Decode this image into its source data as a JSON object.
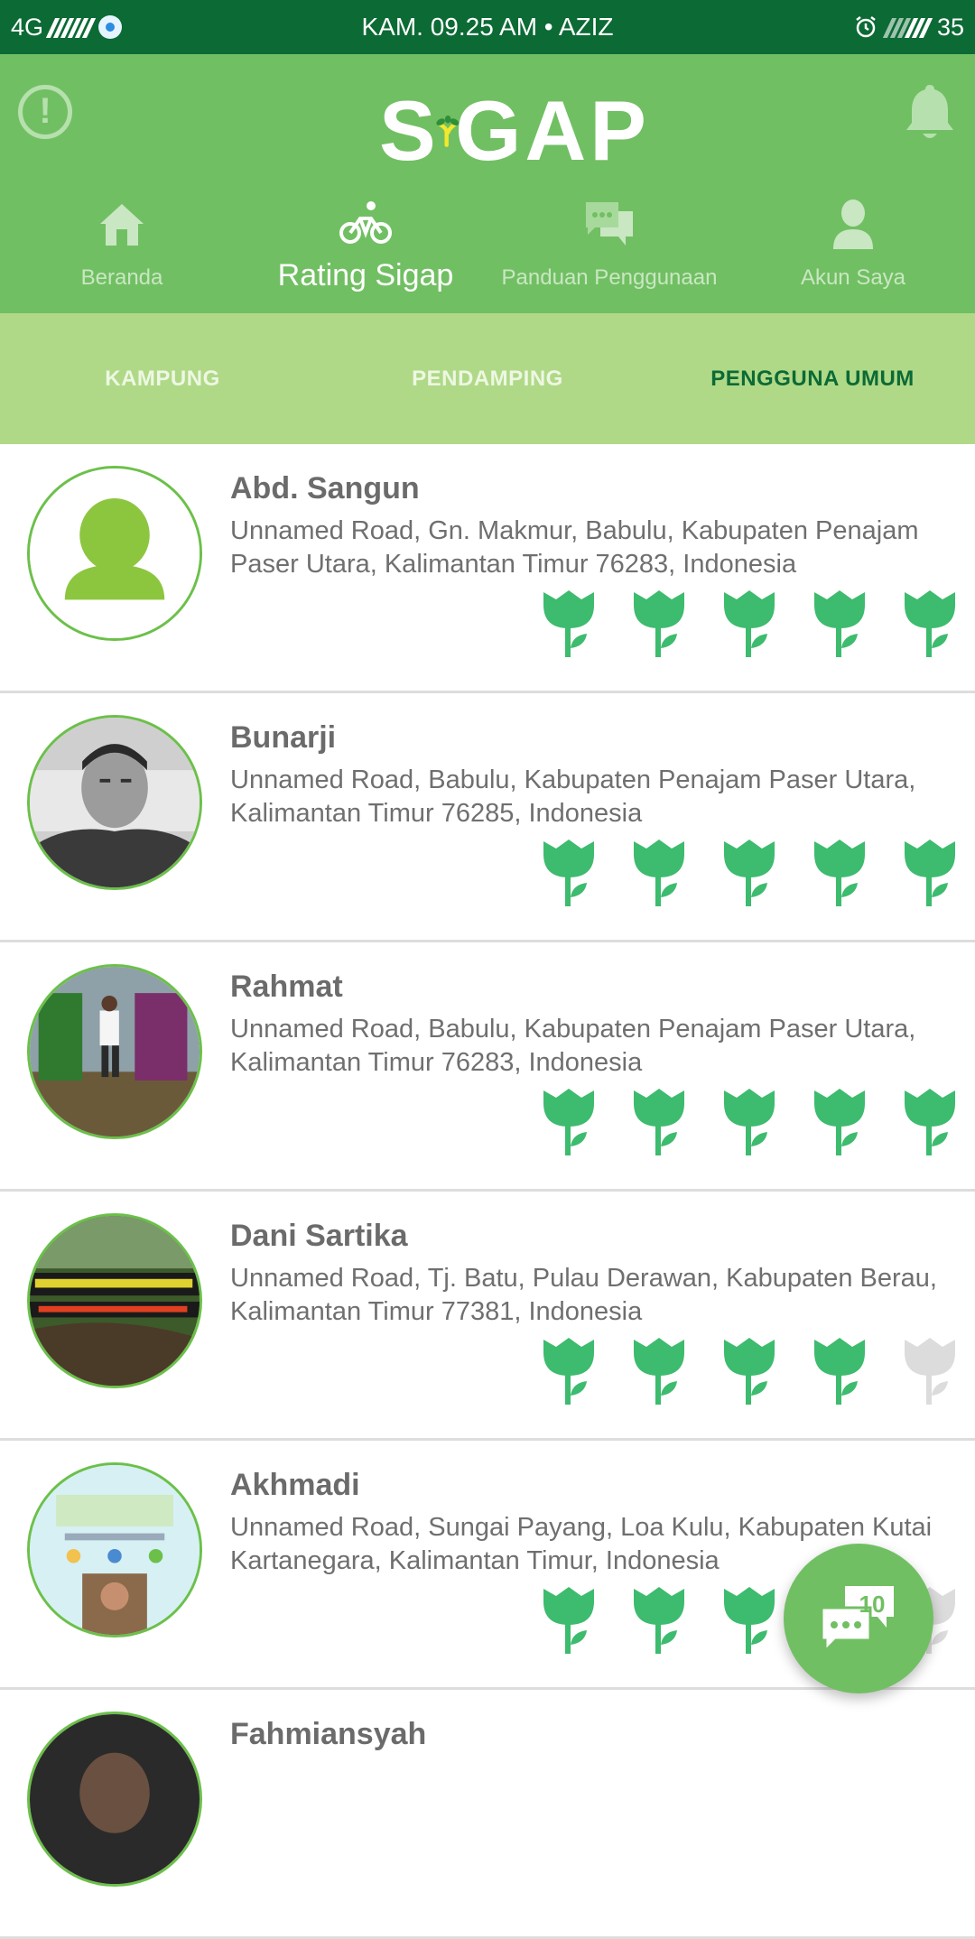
{
  "status_bar": {
    "network": "4G",
    "center_text": "KAM. 09.25 AM • AZIZ",
    "battery": "35",
    "icons": [
      "signal-icon",
      "data-saver-icon",
      "alarm-icon",
      "battery-icon"
    ]
  },
  "header": {
    "logo_left": "S",
    "logo_right": "GAP",
    "icons": [
      "alert-icon",
      "bell-icon"
    ]
  },
  "nav_tabs": [
    {
      "label": "Beranda",
      "icon": "home-icon",
      "active": false
    },
    {
      "label": "Rating Sigap",
      "icon": "bike-icon",
      "active": true
    },
    {
      "label": "Panduan Penggunaan",
      "icon": "chat-icon",
      "active": false
    },
    {
      "label": "Akun Saya",
      "icon": "person-icon",
      "active": false
    }
  ],
  "sub_tabs": [
    {
      "label": "KAMPUNG",
      "active": false
    },
    {
      "label": "PENDAMPING",
      "active": false
    },
    {
      "label": "PENGGUNA UMUM",
      "active": true
    }
  ],
  "users": [
    {
      "name": "Abd. Sangun",
      "address": "Unnamed Road, Gn. Makmur, Babulu, Kabupaten Penajam Paser Utara, Kalimantan Timur 76283, Indonesia",
      "rating": 5,
      "avatar": "default-avatar"
    },
    {
      "name": "Bunarji",
      "address": "Unnamed Road, Babulu, Kabupaten Penajam Paser Utara, Kalimantan Timur 76285, Indonesia",
      "rating": 5,
      "avatar": "photo"
    },
    {
      "name": "Rahmat",
      "address": "Unnamed Road, Babulu, Kabupaten Penajam Paser Utara, Kalimantan Timur 76283, Indonesia",
      "rating": 5,
      "avatar": "photo"
    },
    {
      "name": "Dani Sartika",
      "address": "Unnamed Road, Tj. Batu, Pulau Derawan, Kabupaten Berau, Kalimantan Timur 77381, Indonesia",
      "rating": 4,
      "avatar": "photo"
    },
    {
      "name": "Akhmadi",
      "address": "Unnamed Road, Sungai Payang, Loa Kulu, Kabupaten Kutai Kartanegara, Kalimantan Timur, Indonesia",
      "rating": 3,
      "avatar": "photo"
    },
    {
      "name": "Fahmiansyah",
      "address": "",
      "rating": 0,
      "avatar": "photo"
    }
  ],
  "fab": {
    "count": "10",
    "icon": "chat-bubbles-icon"
  },
  "colors": {
    "status_bar": "#0c6a35",
    "header": "#71bf63",
    "subtab_bar": "#afd987",
    "tulip_active": "#3dbb6e",
    "tulip_inactive": "#dcdcdc"
  }
}
